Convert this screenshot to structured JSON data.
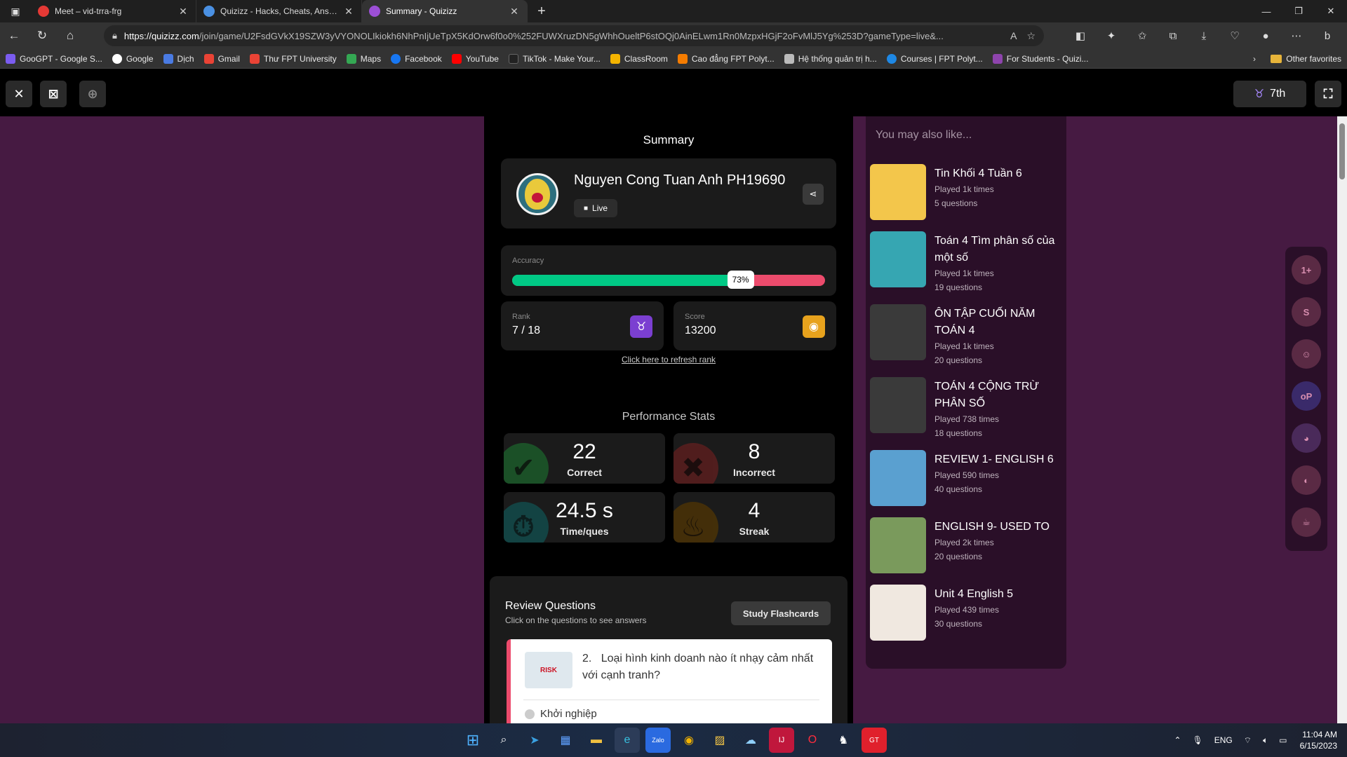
{
  "browser": {
    "tabs": [
      {
        "title": "Meet – vid-trra-frg",
        "color": "#e53935"
      },
      {
        "title": "Quizizz - Hacks, Cheats, Answers...",
        "color": "#4a90e2"
      },
      {
        "title": "Summary - Quizizz",
        "color": "#9c4fd6"
      }
    ],
    "url_host": "https://quizizz.com",
    "url_path": "/join/game/U2FsdGVkX19SZW3yVYONOLIkiokh6NhPnIjUeTpX5KdOrw6f0o0%252FUWXruzDN5gWhhOueltP6stOQj0AinELwm1Rn0MzpxHGjF2oFvMlJ5Yg%253D?gameType=live&...",
    "bookmarks": [
      {
        "label": "GooGPT - Google S...",
        "color": "#7b5cf0"
      },
      {
        "label": "Google",
        "color": "#ffffff"
      },
      {
        "label": "Dịch",
        "color": "#4a7be3"
      },
      {
        "label": "Gmail",
        "color": "#ea4335"
      },
      {
        "label": "Thư FPT University",
        "color": "#ea4335"
      },
      {
        "label": "Maps",
        "color": "#34a853"
      },
      {
        "label": "Facebook",
        "color": "#1877f2"
      },
      {
        "label": "YouTube",
        "color": "#ff0000"
      },
      {
        "label": "TikTok - Make Your...",
        "color": "#222222"
      },
      {
        "label": "ClassRoom",
        "color": "#f4b400"
      },
      {
        "label": "Cao đẳng FPT Polyt...",
        "color": "#f57c00"
      },
      {
        "label": "Hệ thống quản trị h...",
        "color": "#bbbbbb"
      },
      {
        "label": "Courses | FPT Polyt...",
        "color": "#1e88e5"
      },
      {
        "label": "For Students - Quizi...",
        "color": "#8e44ad"
      }
    ],
    "other_favorites": "Other favorites"
  },
  "header": {
    "rank_pill": "7th"
  },
  "summary": {
    "title": "Summary",
    "player_name": "Nguyen Cong Tuan Anh PH19690",
    "mode": "Live",
    "accuracy_label": "Accuracy",
    "accuracy_pct": 73,
    "accuracy_text": "73%",
    "rank_label": "Rank",
    "rank_value": "7 / 18",
    "score_label": "Score",
    "score_value": "13200",
    "refresh_link": "Click here to refresh rank"
  },
  "performance": {
    "title": "Performance Stats",
    "correct": {
      "value": "22",
      "label": "Correct"
    },
    "incorrect": {
      "value": "8",
      "label": "Incorrect"
    },
    "time": {
      "value": "24.5 s",
      "label": "Time/ques"
    },
    "streak": {
      "value": "4",
      "label": "Streak"
    }
  },
  "review": {
    "title": "Review Questions",
    "subtitle": "Click on the questions to see answers",
    "flashcards": "Study Flashcards",
    "question_number": "2.",
    "question_text": "Loại hình kinh doanh nào ít nhạy cảm nhất với cạnh tranh?",
    "option_1": "Khởi nghiệp"
  },
  "suggestions": {
    "title": "You may also like...",
    "items": [
      {
        "title": "Tin Khối 4 Tuần 6",
        "played": "Played 1k times",
        "questions": "5 questions",
        "color": "#f3c64b"
      },
      {
        "title": "Toán 4 Tìm phân số của một số",
        "played": "Played 1k times",
        "questions": "19 questions",
        "color": "#36a6b2"
      },
      {
        "title": "ÔN TẬP CUỐI NĂM TOÁN 4",
        "played": "Played 1k times",
        "questions": "20 questions",
        "color": "#3a3a3a"
      },
      {
        "title": "TOÁN 4 CỘNG TRỪ PHÂN SỐ",
        "played": "Played 738 times",
        "questions": "18 questions",
        "color": "#3a3a3a"
      },
      {
        "title": "REVIEW 1- ENGLISH 6",
        "played": "Played 590 times",
        "questions": "40 questions",
        "color": "#5aa0d0"
      },
      {
        "title": "ENGLISH 9- USED TO",
        "played": "Played 2k times",
        "questions": "20 questions",
        "color": "#7a9a5c"
      },
      {
        "title": "Unit 4 English 5",
        "played": "Played 439 times",
        "questions": "30 questions",
        "color": "#f0e8e0"
      }
    ]
  },
  "taskbar": {
    "lang": "ENG",
    "time": "11:04 AM",
    "date": "6/15/2023"
  }
}
